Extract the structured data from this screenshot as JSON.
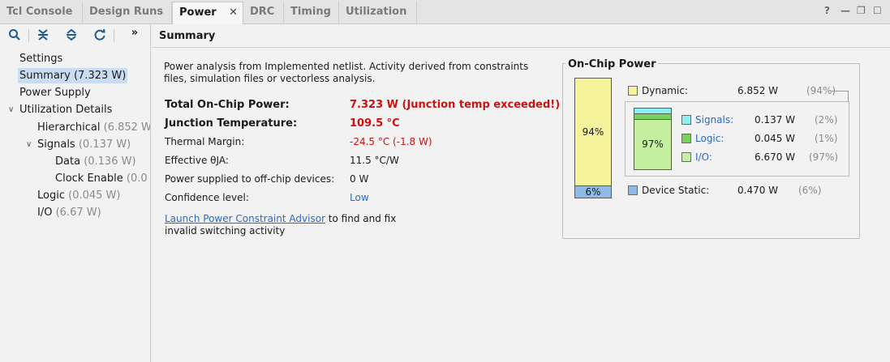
{
  "tabs": [
    {
      "label": "Tcl Console",
      "active": false
    },
    {
      "label": "Design Runs",
      "active": false
    },
    {
      "label": "Power",
      "active": true
    },
    {
      "label": "DRC",
      "active": false
    },
    {
      "label": "Timing",
      "active": false
    },
    {
      "label": "Utilization",
      "active": false
    }
  ],
  "window_controls": {
    "help": "?",
    "minimize": "—",
    "restore": "❐",
    "maximize": "☐"
  },
  "toolbar": {
    "icons": [
      "search-icon",
      "collapse-all-icon",
      "expand-all-icon",
      "refresh-icon"
    ],
    "overflow": "»"
  },
  "tree": {
    "settings": "Settings",
    "summary": "Summary",
    "summary_value": "(7.323 W)",
    "power_supply": "Power Supply",
    "utilization_details": "Utilization Details",
    "hierarchical": "Hierarchical",
    "hierarchical_value": "(6.852 W",
    "signals": "Signals",
    "signals_value": "(0.137 W)",
    "data": "Data",
    "data_value": "(0.136 W)",
    "clock_enable": "Clock Enable",
    "clock_enable_value": "(0.0",
    "logic": "Logic",
    "logic_value": "(0.045 W)",
    "io": "I/O",
    "io_value": "(6.67 W)"
  },
  "header": {
    "title": "Summary"
  },
  "summary": {
    "intro_line1": "Power analysis from Implemented netlist. Activity derived from constraints",
    "intro_line2": "files, simulation files or vectorless analysis.",
    "rows": {
      "total_label": "Total On-Chip Power:",
      "total_value": "7.323 W (Junction temp exceeded!)",
      "junction_label": "Junction Temperature:",
      "junction_value": "109.5 °C",
      "thermal_label": "Thermal Margin:",
      "thermal_value": "-24.5 °C (-1.8 W)",
      "theta_label": "Effective θJA:",
      "theta_value": "11.5 °C/W",
      "offchip_label": "Power supplied to off-chip devices:",
      "offchip_value": "0 W",
      "confidence_label": "Confidence level:",
      "confidence_value": "Low"
    },
    "link_text": "Launch Power Constraint Advisor",
    "link_suffix": " to find and fix",
    "link_line2": "invalid switching activity"
  },
  "onchip": {
    "title": "On-Chip Power",
    "dynamic_fraction": 0.94,
    "dynamic_bar_label": "94%",
    "static_bar_label": "6%",
    "dynamic": {
      "label": "Dynamic:",
      "value": "6.852 W",
      "pct": "(94%)"
    },
    "signals": {
      "label": "Signals:",
      "value": "0.137 W",
      "pct": "(2%)"
    },
    "logic": {
      "label": "Logic:",
      "value": "0.045 W",
      "pct": "(1%)"
    },
    "io": {
      "label": "I/O:",
      "value": "6.670 W",
      "pct": "(97%)"
    },
    "io_bar_label": "97%",
    "static": {
      "label": "Device Static:",
      "value": "0.470 W",
      "pct": "(6%)"
    },
    "colors": {
      "dynamic": "#f5f49a",
      "static": "#8fb9e6",
      "signals": "#8ef0f0",
      "logic": "#79d25c",
      "io": "#c5f0a0"
    }
  }
}
